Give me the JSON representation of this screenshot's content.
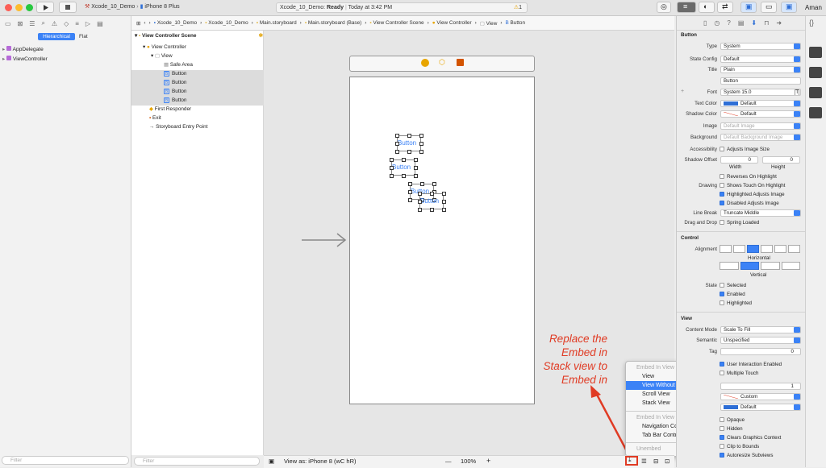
{
  "toolbar": {
    "scheme": "Xcode_10_Demo",
    "device": "iPhone 8 Plus",
    "status_project": "Xcode_10_Demo:",
    "status_state": "Ready",
    "status_time": "Today at 3:42 PM",
    "warning_count": "1",
    "user": "Aman"
  },
  "navigator": {
    "tab_hierarchical": "Hierarchical",
    "tab_flat": "Flat",
    "items": [
      "AppDelegate",
      "ViewController"
    ],
    "filter_placeholder": "Filter"
  },
  "jumpbar": {
    "crumbs": [
      "Xcode_10_Demo",
      "Xcode_10_Demo",
      "Main.storyboard",
      "Main.storyboard (Base)",
      "View Controller Scene",
      "View Controller",
      "View",
      "Button"
    ]
  },
  "outline": {
    "rows": [
      "View Controller Scene",
      "View Controller",
      "View",
      "Safe Area",
      "Button",
      "Button",
      "Button",
      "Button",
      "First Responder",
      "Exit",
      "Storyboard Entry Point"
    ],
    "filter_placeholder": "Filter"
  },
  "canvas": {
    "buttons": [
      "Button",
      "Button",
      "Button",
      "Button"
    ],
    "view_as": "View as: iPhone 8 (wC hR)",
    "zoom": "100%",
    "zoom_minus": "—",
    "zoom_plus": "+"
  },
  "annotation": {
    "line1": "Replace the",
    "line2": "Embed in",
    "line3": "Stack view to",
    "line4": "Embed in",
    "color": "#e03b24"
  },
  "menu": {
    "header1": "Embed In View",
    "items1": [
      "View",
      "View Without Inset",
      "Scroll View",
      "Stack View"
    ],
    "header2": "Embed In View Controller",
    "items2": [
      "Navigation Controller",
      "Tab Bar Controller"
    ],
    "footer": "Unembed",
    "highlighted": "View Without Inset"
  },
  "inspector": {
    "section_button": "Button",
    "type_label": "Type",
    "type_value": "System",
    "state_label": "State Config",
    "state_value": "Default",
    "title_label": "Title",
    "title_value": "Plain",
    "title_text": "Button",
    "font_label": "Font",
    "font_value": "System 15.0",
    "textcolor_label": "Text Color",
    "textcolor_value": "Default",
    "shadowcolor_label": "Shadow Color",
    "shadowcolor_value": "Default",
    "image_label": "Image",
    "image_placeholder": "Default Image",
    "background_label": "Background",
    "background_placeholder": "Default Background Image",
    "accessibility_label": "Accessibility",
    "accessibility_value": "Adjusts Image Size",
    "shadowoffset_label": "Shadow Offset",
    "shadow_w": "0",
    "shadow_h": "0",
    "width_label": "Width",
    "height_label": "Height",
    "drawing_label": "Drawing",
    "reverses": "Reverses On Highlight",
    "shows_touch": "Shows Touch On Highlight",
    "highlighted_adjusts": "Highlighted Adjusts Image",
    "disabled_adjusts": "Disabled Adjusts Image",
    "linebreak_label": "Line Break",
    "linebreak_value": "Truncate Middle",
    "dragdrop_label": "Drag and Drop",
    "spring_loaded": "Spring Loaded",
    "section_control": "Control",
    "alignment_label": "Alignment",
    "horizontal": "Horizontal",
    "vertical": "Vertical",
    "state2_label": "State",
    "selected": "Selected",
    "enabled": "Enabled",
    "highlighted": "Highlighted",
    "section_view": "View",
    "contentmode_label": "Content Mode",
    "contentmode_value": "Scale To Fill",
    "semantic_label": "Semantic",
    "semantic_value": "Unspecified",
    "tag_label": "Tag",
    "tag_value": "0",
    "user_interaction": "User Interaction Enabled",
    "multiple_touch": "Multiple Touch",
    "alpha_value": "1",
    "tint_value": "Custom",
    "bg_value": "Default",
    "opaque": "Opaque",
    "hidden": "Hidden",
    "clears": "Clears Graphics Context",
    "clip": "Clip to Bounds",
    "autoresize": "Autoresize Subviews"
  }
}
